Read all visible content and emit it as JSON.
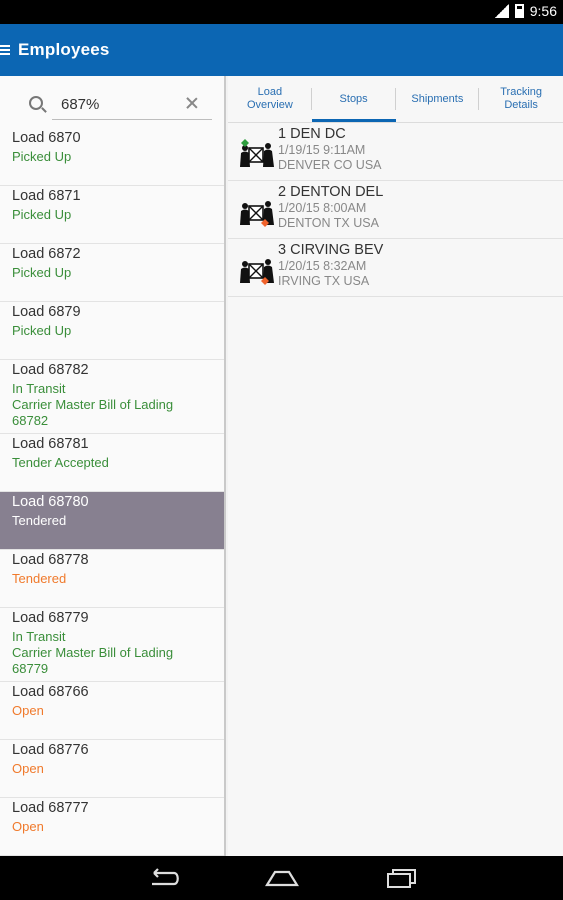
{
  "status_bar": {
    "time": "9:56"
  },
  "app_bar": {
    "title": "Employees"
  },
  "search": {
    "value": "687%"
  },
  "loads": [
    {
      "title": "Load 6870",
      "lines": [
        {
          "text": "Picked Up",
          "tone": "green"
        }
      ]
    },
    {
      "title": "Load 6871",
      "lines": [
        {
          "text": "Picked Up",
          "tone": "green"
        }
      ]
    },
    {
      "title": "Load 6872",
      "lines": [
        {
          "text": "Picked Up",
          "tone": "green"
        }
      ]
    },
    {
      "title": "Load 6879",
      "lines": [
        {
          "text": "Picked Up",
          "tone": "green"
        }
      ]
    },
    {
      "title": "Load 68782",
      "lines": [
        {
          "text": "In Transit",
          "tone": "green"
        },
        {
          "text": "Carrier Master Bill of Lading",
          "tone": "green"
        },
        {
          "text": "68782",
          "tone": "green"
        }
      ]
    },
    {
      "title": "Load 68781",
      "lines": [
        {
          "text": "Tender Accepted",
          "tone": "green"
        }
      ]
    },
    {
      "title": "Load 68780",
      "lines": [
        {
          "text": "Tendered",
          "tone": "white"
        }
      ],
      "selected": true
    },
    {
      "title": "Load 68778",
      "lines": [
        {
          "text": "Tendered",
          "tone": "orange"
        }
      ]
    },
    {
      "title": "Load 68779",
      "lines": [
        {
          "text": "In Transit",
          "tone": "green"
        },
        {
          "text": "Carrier Master Bill of Lading",
          "tone": "green"
        },
        {
          "text": "68779",
          "tone": "green"
        }
      ]
    },
    {
      "title": "Load 68766",
      "lines": [
        {
          "text": "Open",
          "tone": "orange"
        }
      ]
    },
    {
      "title": "Load 68776",
      "lines": [
        {
          "text": "Open",
          "tone": "orange"
        }
      ]
    },
    {
      "title": "Load 68777",
      "lines": [
        {
          "text": "Open",
          "tone": "orange"
        }
      ]
    }
  ],
  "tabs": [
    {
      "label": "Load\nOverview",
      "active": false
    },
    {
      "label": "Stops",
      "active": true
    },
    {
      "label": "Shipments",
      "active": false
    },
    {
      "label": "Tracking\nDetails",
      "active": false
    }
  ],
  "stops": [
    {
      "name": "1 DEN DC",
      "datetime": "1/19/15 9:11AM",
      "location": "DENVER CO USA",
      "type": "pickup"
    },
    {
      "name": "2 DENTON DEL",
      "datetime": "1/20/15 8:00AM",
      "location": "DENTON TX USA",
      "type": "delivery"
    },
    {
      "name": "3 CIRVING BEV",
      "datetime": "1/20/15 8:32AM",
      "location": "IRVING TX USA",
      "type": "delivery"
    }
  ],
  "colors": {
    "app_bar": "#0c66b3",
    "status_green": "#3a8e3a",
    "status_orange": "#f07a2c",
    "selected_row": "#878090",
    "pickup_marker": "#2e9e3e",
    "delivery_marker": "#f0632c"
  },
  "icons": {
    "menu": "menu-icon",
    "search": "search-icon",
    "clear": "close-icon",
    "stop_pickup": "pickup-stop-icon",
    "stop_delivery": "delivery-stop-icon",
    "back": "back-icon",
    "home": "home-icon",
    "recents": "recents-icon"
  }
}
